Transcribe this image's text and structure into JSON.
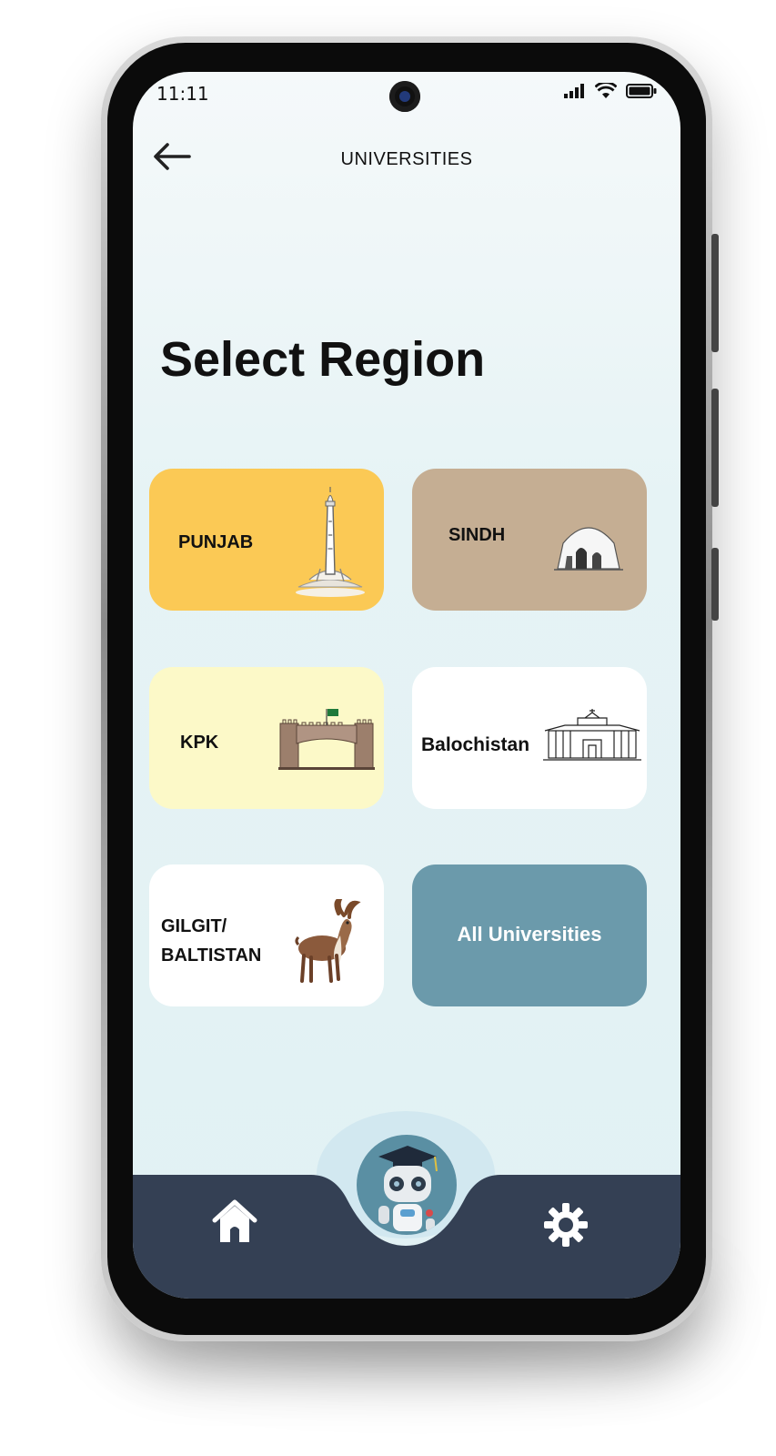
{
  "status": {
    "time": "11:11",
    "signal_icon": "signal-icon",
    "wifi_icon": "wifi-icon",
    "battery_icon": "battery-icon"
  },
  "header": {
    "title": "UNIVERSITIES",
    "back_icon": "arrow-left-icon"
  },
  "page": {
    "title": "Select Region"
  },
  "regions": [
    {
      "label": "PUNJAB",
      "icon": "minar-e-pakistan-icon",
      "color": "#fbc955"
    },
    {
      "label": "SINDH",
      "icon": "mazar-e-quaid-icon",
      "color": "#c5ae93"
    },
    {
      "label": "KPK",
      "icon": "khyber-pass-gate-icon",
      "color": "#fcf9c8"
    },
    {
      "label": "Balochistan",
      "icon": "balochistan-building-icon",
      "color": "#ffffff"
    },
    {
      "label_line1": "GILGIT/",
      "label_line2": "BALTISTAN",
      "icon": "markhor-icon",
      "color": "#ffffff"
    },
    {
      "label": "All Universities",
      "color": "#6b9aab"
    }
  ],
  "bottom_nav": {
    "home_icon": "home-icon",
    "assistant_icon": "robot-graduate-icon",
    "settings_icon": "gear-icon",
    "bar_color": "#344054"
  }
}
